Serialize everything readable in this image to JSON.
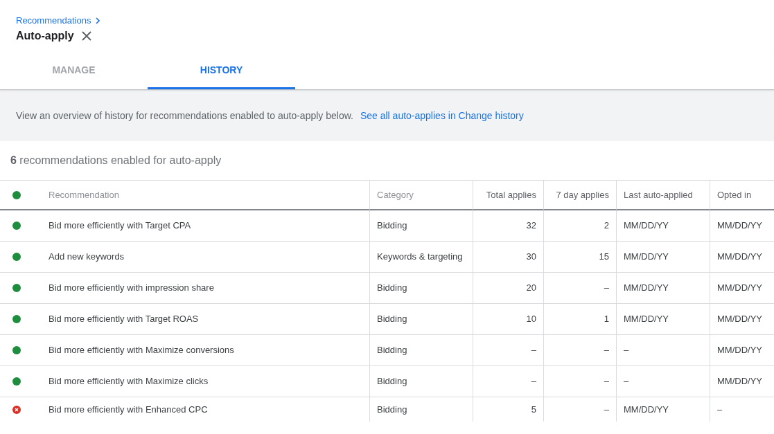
{
  "breadcrumb": {
    "label": "Recommendations"
  },
  "title": "Auto-apply",
  "tabs": [
    {
      "label": "MANAGE",
      "selected": false
    },
    {
      "label": "HISTORY",
      "selected": true
    }
  ],
  "banner": {
    "text": "View an overview of history for recommendations enabled to auto-apply below.",
    "link": "See all auto-applies in Change history"
  },
  "summary": "**6** recommendations enabled for auto-apply",
  "table": {
    "columns": [
      {
        "kind": "text",
        "label": "Recommendation",
        "muted": true
      },
      {
        "kind": "text",
        "label": "Category",
        "muted": true
      },
      {
        "kind": "number",
        "label": "Total applies",
        "muted": false
      },
      {
        "kind": "number",
        "label": "7 day applies",
        "muted": false
      },
      {
        "kind": "text",
        "label": "Last auto-applied",
        "muted": false
      },
      {
        "kind": "text",
        "label": "Opted in",
        "muted": false
      }
    ],
    "rows": [
      {
        "enabled": true,
        "cells": [
          "Bid more efficiently with Target CPA",
          "Bidding",
          "32",
          "2",
          "MM/DD/YY",
          "MM/DD/YY"
        ]
      },
      {
        "enabled": true,
        "cells": [
          "Add new keywords",
          "Keywords & targeting",
          "30",
          "15",
          "MM/DD/YY",
          "MM/DD/YY"
        ]
      },
      {
        "enabled": true,
        "cells": [
          "Bid more efficiently with impression share",
          "Bidding",
          "20",
          "–",
          "MM/DD/YY",
          "MM/DD/YY"
        ]
      },
      {
        "enabled": true,
        "cells": [
          "Bid more efficiently with Target ROAS",
          "Bidding",
          "10",
          "1",
          "MM/DD/YY",
          "MM/DD/YY"
        ]
      },
      {
        "enabled": true,
        "cells": [
          "Bid more efficiently with Maximize conversions",
          "Bidding",
          "–",
          "–",
          "–",
          "MM/DD/YY"
        ]
      },
      {
        "enabled": true,
        "cells": [
          "Bid more efficiently with Maximize clicks",
          "Bidding",
          "–",
          "–",
          "–",
          "MM/DD/YY"
        ]
      },
      {
        "enabled": false,
        "cells": [
          "Bid more efficiently with Enhanced CPC",
          "Bidding",
          "5",
          "–",
          "MM/DD/YY",
          "–"
        ]
      }
    ]
  }
}
